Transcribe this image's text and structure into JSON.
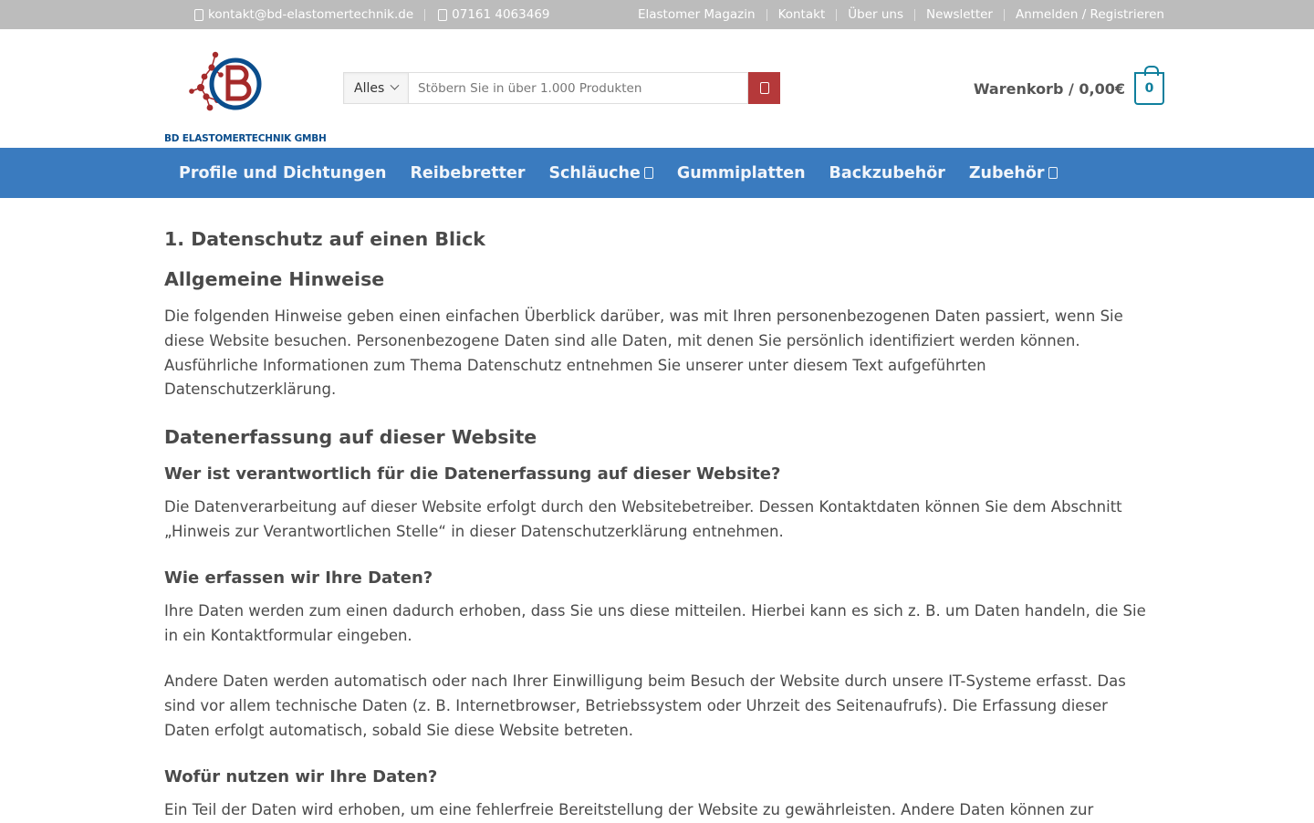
{
  "topbar": {
    "email": "kontakt@bd-elastomertechnik.de",
    "phone": "07161 4063469",
    "links": [
      "Elastomer Magazin",
      "Kontakt",
      "Über uns",
      "Newsletter",
      "Anmelden / Registrieren"
    ]
  },
  "logo": {
    "text": "BD ELASTOMERTECHNIK GMBH"
  },
  "search": {
    "category": "Alles",
    "placeholder": "Stöbern Sie in über 1.000 Produkten"
  },
  "cart": {
    "label": "Warenkorb / 0,00€",
    "count": "0"
  },
  "nav": {
    "items": [
      "Profile und Dichtungen",
      "Reibebretter",
      "Schläuche",
      "Gummiplatten",
      "Backzubehör",
      "Zubehör"
    ]
  },
  "content": {
    "h1": "1. Datenschutz auf einen Blick",
    "h_allgemein": "Allgemeine Hinweise",
    "p_allgemein": "Die folgenden Hinweise geben einen einfachen Überblick darüber, was mit Ihren personenbezogenen Daten passiert, wenn Sie diese Website besuchen. Personenbezogene Daten sind alle Daten, mit denen Sie persönlich identifiziert werden können. Ausführliche Informationen zum Thema Datenschutz entnehmen Sie unserer unter diesem Text aufgeführten Datenschutzerklärung.",
    "h_erfassung": "Datenerfassung auf dieser Website",
    "h_wer": "Wer ist verantwortlich für die Datenerfassung auf dieser Website?",
    "p_wer": "Die Datenverarbeitung auf dieser Website erfolgt durch den Websitebetreiber. Dessen Kontaktdaten können Sie dem Abschnitt „Hinweis zur Verantwortlichen Stelle“ in dieser Datenschutzerklärung entnehmen.",
    "h_wie": "Wie erfassen wir Ihre Daten?",
    "p_wie1": "Ihre Daten werden zum einen dadurch erhoben, dass Sie uns diese mitteilen. Hierbei kann es sich z. B. um Daten handeln, die Sie in ein Kontaktformular eingeben.",
    "p_wie2": "Andere Daten werden automatisch oder nach Ihrer Einwilligung beim Besuch der Website durch unsere IT-Systeme erfasst. Das sind vor allem technische Daten (z. B. Internetbrowser, Betriebssystem oder Uhrzeit des Seitenaufrufs). Die Erfassung dieser Daten erfolgt automatisch, sobald Sie diese Website betreten.",
    "h_wofuer": "Wofür nutzen wir Ihre Daten?",
    "p_wofuer": "Ein Teil der Daten wird erhoben, um eine fehlerfreie Bereitstellung der Website zu gewährleisten. Andere Daten können zur"
  },
  "colors": {
    "topbar": "#bcbcbc",
    "nav": "#3a7bbf",
    "search_button": "#b5393a",
    "cart_accent": "#0f7f9d",
    "logo_blue": "#0a4d8c",
    "logo_red": "#a52a2a"
  },
  "icons": {
    "email": "envelope-icon",
    "phone": "phone-icon",
    "search": "search-icon",
    "cart": "cart-icon",
    "dropdown": "chevron-down-icon"
  }
}
